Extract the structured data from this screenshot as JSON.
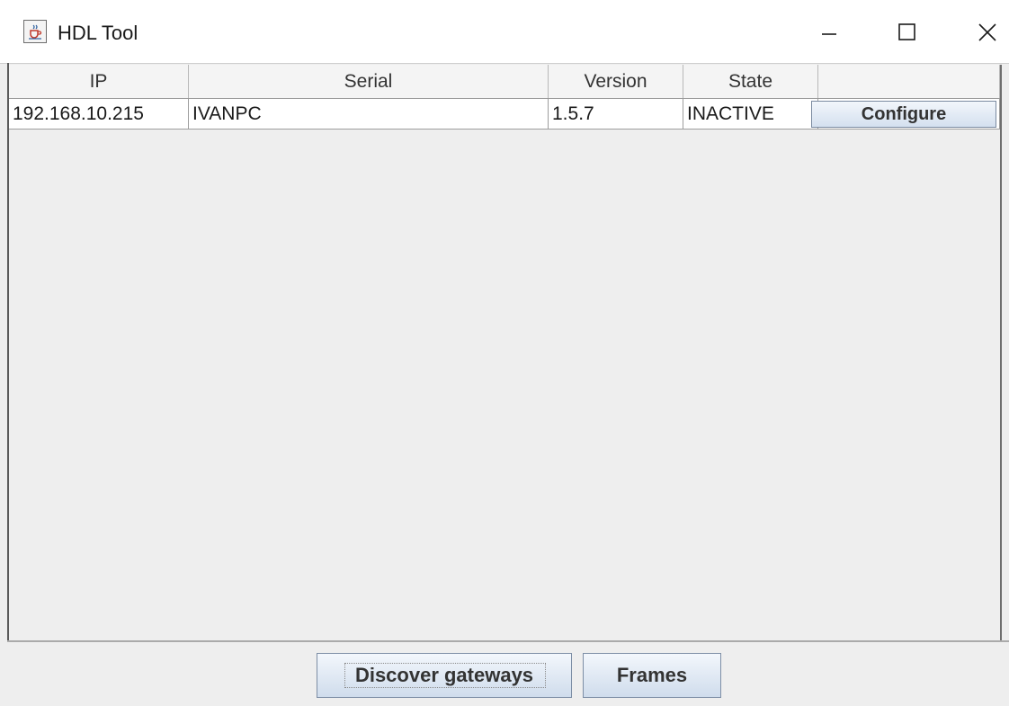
{
  "window": {
    "title": "HDL Tool",
    "icon": "java-cup-icon",
    "controls": [
      "minimize-icon",
      "maximize-icon",
      "close-icon"
    ]
  },
  "table": {
    "columns": [
      "IP",
      "Serial",
      "Version",
      "State",
      ""
    ],
    "rows": [
      {
        "ip": "192.168.10.215",
        "serial": "IVANPC",
        "version": "1.5.7",
        "state": "INACTIVE",
        "action_label": "Configure"
      }
    ]
  },
  "buttons": {
    "discover_label": "Discover gateways",
    "frames_label": "Frames"
  }
}
